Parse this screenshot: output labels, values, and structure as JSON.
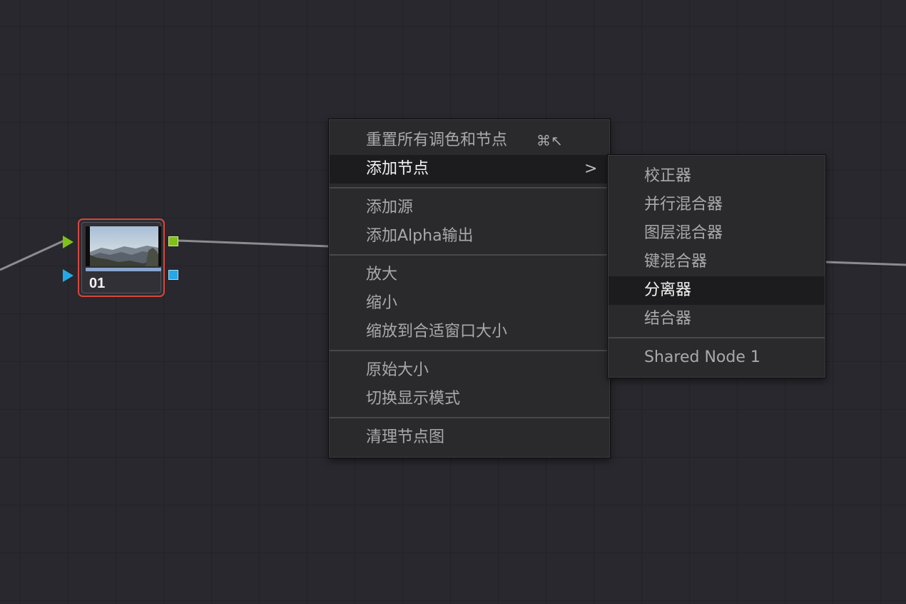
{
  "node": {
    "label": "01",
    "border_color": "#d8453c",
    "thumbnail": "mountain-landscape-thumbnail"
  },
  "ports": {
    "input_rgb_color": "#7ec118",
    "input_alpha_color": "#25a8e8",
    "output_rgb_color": "#7ec118",
    "output_alpha_color": "#25a8e8"
  },
  "context_menu": {
    "items": [
      {
        "label": "重置所有调色和节点",
        "shortcut": "⌘↖"
      },
      {
        "label": "添加节点",
        "submenu_icon": "chevron-right-icon",
        "chevron": ">"
      },
      {
        "label": "添加源"
      },
      {
        "label": "添加Alpha输出"
      },
      {
        "label": "放大"
      },
      {
        "label": "缩小"
      },
      {
        "label": "缩放到合适窗口大小"
      },
      {
        "label": "原始大小"
      },
      {
        "label": "切换显示模式"
      },
      {
        "label": "清理节点图"
      }
    ]
  },
  "submenu": {
    "items": [
      {
        "label": "校正器"
      },
      {
        "label": "并行混合器"
      },
      {
        "label": "图层混合器"
      },
      {
        "label": "键混合器"
      },
      {
        "label": "分离器"
      },
      {
        "label": "结合器"
      },
      {
        "label": "Shared Node 1"
      }
    ]
  },
  "colors": {
    "canvas_bg": "#28282e",
    "menu_bg": "#2a2a2c",
    "menu_highlight": "#1c1c1e",
    "menu_text": "#a9a9ad",
    "menu_text_active": "#f2f2f2"
  }
}
